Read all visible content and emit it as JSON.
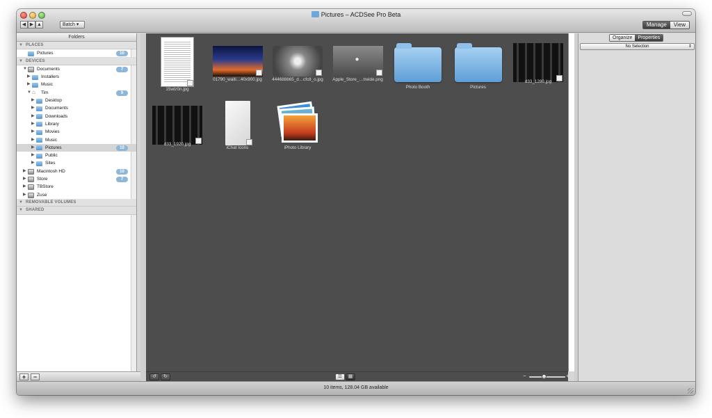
{
  "window": {
    "title": "Pictures – ACDSee Pro Beta",
    "modes": [
      "Manage",
      "View"
    ],
    "active_mode": "Manage",
    "batch_label": "Batch"
  },
  "sidebar": {
    "header": "Folders",
    "sections": {
      "places": "PLACES",
      "devices": "DEVICES",
      "removable": "REMOVABLE VOLUMES",
      "shared": "SHARED"
    },
    "places": [
      {
        "label": "Pictures",
        "badge": "10"
      }
    ],
    "devices": [
      {
        "label": "Documents",
        "badge": "7",
        "level": 0,
        "icon": "drive-icon",
        "expanded": true
      },
      {
        "label": "Installers",
        "level": 1,
        "icon": "folder-icon"
      },
      {
        "label": "Music",
        "level": 1,
        "icon": "folder-icon"
      },
      {
        "label": "Tim",
        "badge": "9",
        "level": 1,
        "icon": "home-icon",
        "expanded": true
      },
      {
        "label": "Desktop",
        "level": 2,
        "icon": "folder-icon"
      },
      {
        "label": "Documents",
        "level": 2,
        "icon": "folder-icon"
      },
      {
        "label": "Downloads",
        "level": 2,
        "icon": "folder-icon"
      },
      {
        "label": "Library",
        "level": 2,
        "icon": "folder-icon"
      },
      {
        "label": "Movies",
        "level": 2,
        "icon": "folder-icon"
      },
      {
        "label": "Music",
        "level": 2,
        "icon": "folder-icon"
      },
      {
        "label": "Pictures",
        "badge": "10",
        "level": 2,
        "icon": "folder-icon",
        "selected": true
      },
      {
        "label": "Public",
        "level": 2,
        "icon": "folder-icon"
      },
      {
        "label": "Sites",
        "level": 2,
        "icon": "folder-icon"
      },
      {
        "label": "Macintosh HD",
        "badge": "10",
        "level": 0,
        "icon": "drive-icon"
      },
      {
        "label": "Store",
        "badge": "7",
        "level": 0,
        "icon": "drive-icon"
      },
      {
        "label": "TBStore",
        "level": 0,
        "icon": "drive-icon"
      },
      {
        "label": "Zuse",
        "level": 0,
        "icon": "drive-icon"
      }
    ]
  },
  "files": [
    {
      "name": "15wlz0n.jpg",
      "kind": "document"
    },
    {
      "name": "01790_waiti…40x900.jpg",
      "kind": "sunset"
    },
    {
      "name": "444688865_d…cfc8_o.jpg",
      "kind": "gray"
    },
    {
      "name": "Apple_Store_…treide.png",
      "kind": "apple"
    },
    {
      "name": "Photo Booth",
      "kind": "folder"
    },
    {
      "name": "Pictures",
      "kind": "folder"
    },
    {
      "name": "d33_1280.jpg",
      "kind": "dark"
    },
    {
      "name": "d33_1920.jpg",
      "kind": "dark"
    },
    {
      "name": "iChat Icons",
      "kind": "blank"
    },
    {
      "name": "iPhoto Library",
      "kind": "iphoto"
    }
  ],
  "right_panel": {
    "tabs": [
      "Organize",
      "Properties"
    ],
    "active_tab": "Properties",
    "selection": "No Selection"
  },
  "status": "10 items, 128.04 GB available",
  "colors": {
    "content_bg": "#4d4d4d",
    "badge": "#8eb6d9",
    "folder": "#6fa8d8"
  }
}
